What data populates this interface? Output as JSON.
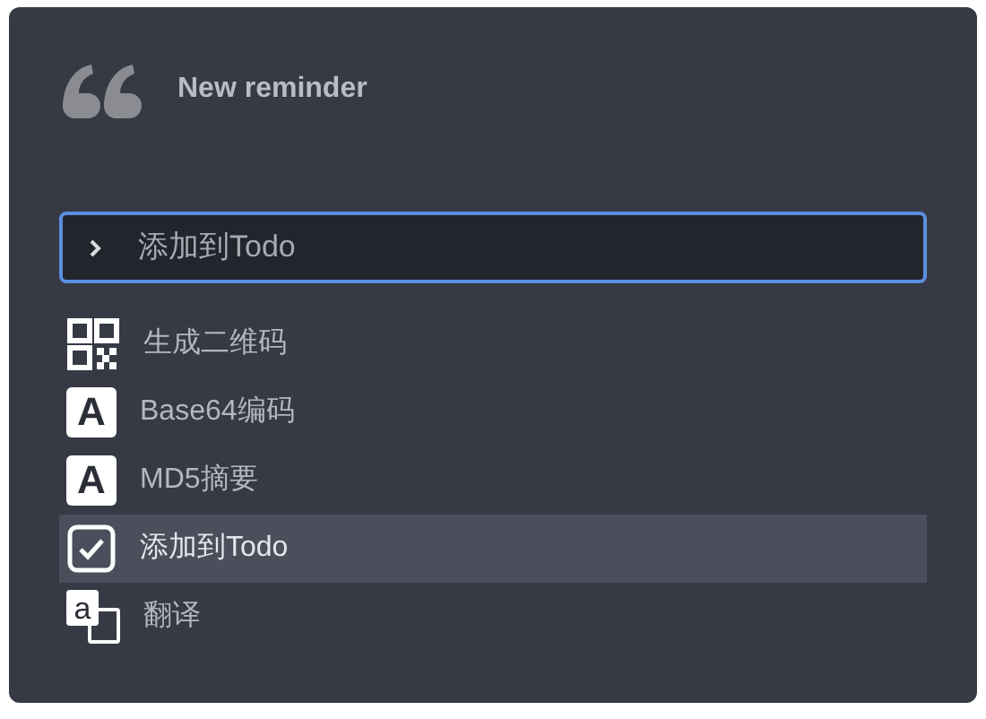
{
  "title": "New reminder",
  "search": {
    "value": "添加到Todo"
  },
  "items": [
    {
      "kind": "qr",
      "label": "生成二维码",
      "selected": false
    },
    {
      "kind": "letter",
      "glyph": "A",
      "label": "Base64编码",
      "selected": false
    },
    {
      "kind": "letter",
      "glyph": "A",
      "label": "MD5摘要",
      "selected": false
    },
    {
      "kind": "check",
      "label": "添加到Todo",
      "selected": true
    },
    {
      "kind": "translate",
      "glyph": "a",
      "label": "翻译",
      "selected": false
    }
  ]
}
